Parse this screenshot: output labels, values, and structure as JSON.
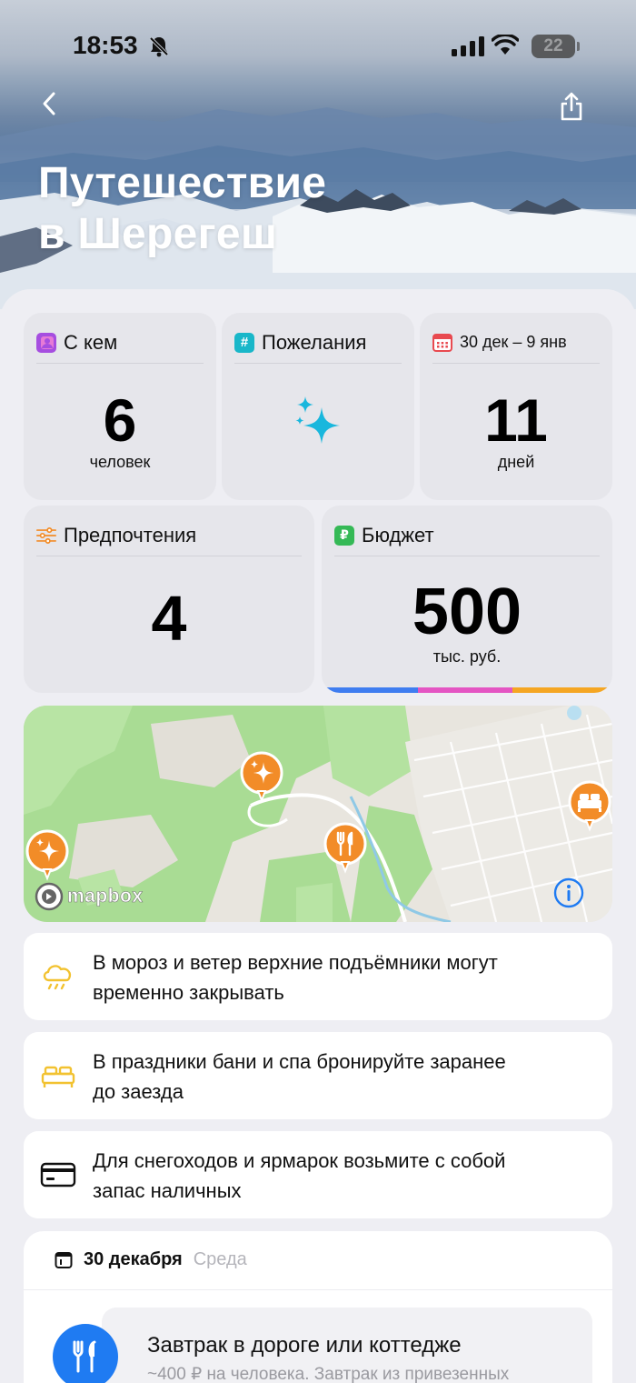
{
  "status_bar": {
    "time": "18:53",
    "battery": "22"
  },
  "header": {
    "title_line1": "Путешествие",
    "title_line2": "в Шерегеш"
  },
  "cards": {
    "with_whom": {
      "label": "С кем",
      "value": "6",
      "unit": "человек"
    },
    "wishes": {
      "label": "Пожелания"
    },
    "dates": {
      "label": "30 дек – 9 янв",
      "value": "11",
      "unit": "дней"
    },
    "preferences": {
      "label": "Предпочтения",
      "value": "4"
    },
    "budget": {
      "label": "Бюджет",
      "value": "500",
      "unit": "тыс. руб."
    }
  },
  "map": {
    "attribution": "mapbox"
  },
  "tips": [
    {
      "icon": "cloud-rain-icon",
      "text_line1": "В мороз и ветер верхние подъёмники могут",
      "text_line2": "временно закрывать"
    },
    {
      "icon": "bed-icon",
      "text_line1": "В праздники бани и спа бронируйте заранее",
      "text_line2": "до заезда"
    },
    {
      "icon": "card-icon",
      "text_line1": "Для снегоходов и ярмарок возьмите с собой",
      "text_line2": "запас наличных"
    }
  ],
  "day": {
    "date": "30 декабря",
    "weekday": "Среда",
    "event_title": "Завтрак в дороге или коттедже",
    "event_sub": "~400 ₽ на человека. Завтрак из привезенных"
  },
  "colors": {
    "accent_blue": "#1f7bf2",
    "orange": "#f28c28",
    "cyan": "#1bb8d6",
    "budget_bar": [
      "#3f7df0",
      "#e455c3",
      "#f5a623"
    ]
  }
}
